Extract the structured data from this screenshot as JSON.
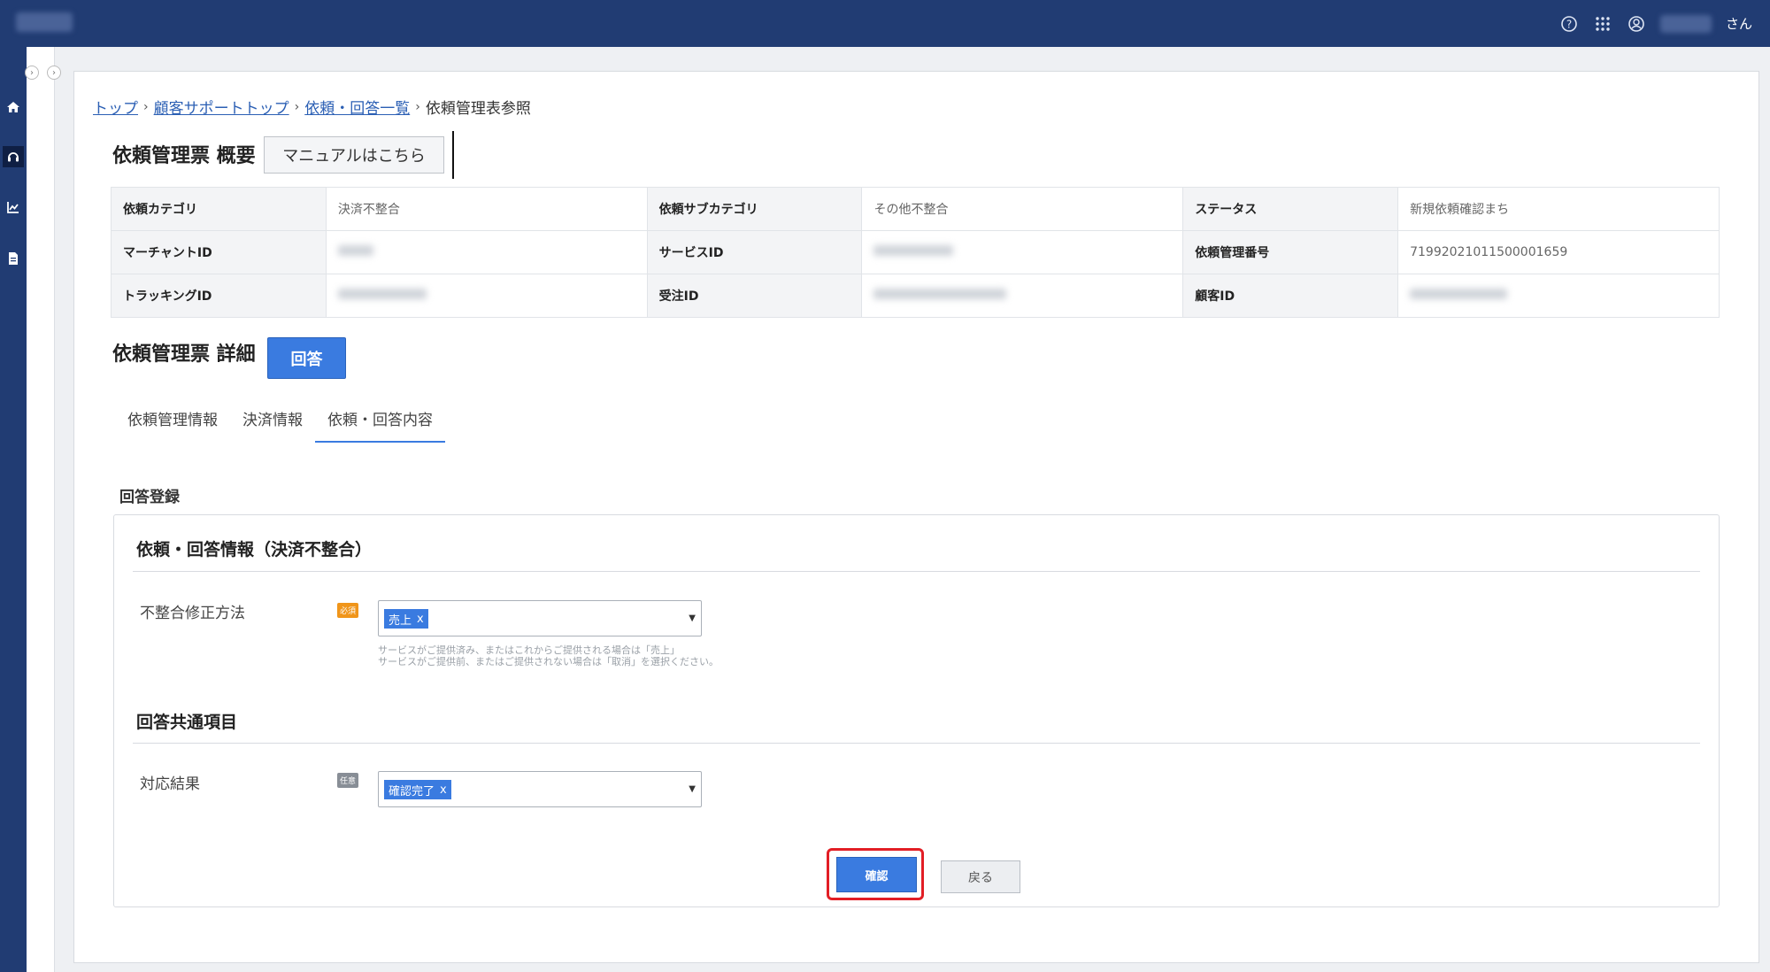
{
  "header": {
    "user_suffix": "さん",
    "icons": [
      "help-circle-icon",
      "apps-grid-icon",
      "account-icon"
    ]
  },
  "sidebar": {
    "icons": [
      "home-icon",
      "support-headset-icon",
      "chart-icon",
      "document-icon"
    ]
  },
  "breadcrumb": {
    "items": [
      "トップ",
      "顧客サポートトップ",
      "依頼・回答一覧"
    ],
    "current": "依頼管理表参照"
  },
  "overview": {
    "title": "依頼管理票 概要",
    "manual_button": "マニュアルはこちら",
    "rows": [
      [
        {
          "label": "依頼カテゴリ",
          "value": "決済不整合"
        },
        {
          "label": "依頼サブカテゴリ",
          "value": "その他不整合"
        },
        {
          "label": "ステータス",
          "value": "新規依頼確認まち"
        }
      ],
      [
        {
          "label": "マーチャントID",
          "value": ""
        },
        {
          "label": "サービスID",
          "value": ""
        },
        {
          "label": "依頼管理番号",
          "value": "71992021011500001659"
        }
      ],
      [
        {
          "label": "トラッキングID",
          "value": ""
        },
        {
          "label": "受注ID",
          "value": ""
        },
        {
          "label": "顧客ID",
          "value": ""
        }
      ]
    ]
  },
  "detail": {
    "title": "依頼管理票 詳細",
    "answer_button": "回答",
    "tabs": [
      "依頼管理情報",
      "決済情報",
      "依頼・回答内容"
    ],
    "active_tab": "依頼・回答内容"
  },
  "form": {
    "section_label": "回答登録",
    "group1_title": "依頼・回答情報（決済不整合）",
    "field1": {
      "label": "不整合修正方法",
      "badge": "必須",
      "selected": "売上",
      "help_line1": "サービスがご提供済み、またはこれからご提供される場合は「売上」",
      "help_line2": "サービスがご提供前、またはご提供されない場合は「取消」を選択ください。"
    },
    "group2_title": "回答共通項目",
    "field2": {
      "label": "対応結果",
      "badge": "任意",
      "selected": "確認完了"
    },
    "chip_remove": "x",
    "confirm_button": "確認",
    "back_button": "戻る"
  }
}
